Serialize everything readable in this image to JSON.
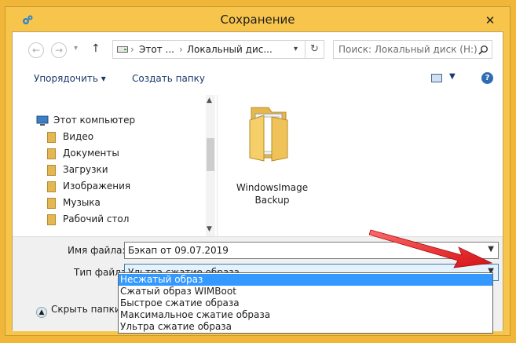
{
  "window": {
    "title": "Сохранение",
    "close_glyph": "✕"
  },
  "navigation": {
    "back_glyph": "←",
    "forward_glyph": "→",
    "recent_glyph": "▾",
    "up_glyph": "↑",
    "breadcrumb": [
      "Этот ...",
      "Локальный дис..."
    ],
    "breadcrumb_separator": "›",
    "address_dropdown_glyph": "▾",
    "refresh_glyph": "↻",
    "search_placeholder": "Поиск: Локальный диск (H:)"
  },
  "toolbar": {
    "organize_label": "Упорядочить ▾",
    "new_folder_label": "Создать папку",
    "view_caret": "▼",
    "help_glyph": "?"
  },
  "nav_pane": {
    "root": "Этот компьютер",
    "items": [
      "Видео",
      "Документы",
      "Загрузки",
      "Изображения",
      "Музыка",
      "Рабочий стол"
    ]
  },
  "content": {
    "items": [
      {
        "name": "WindowsImageBackup",
        "icon": "folder-icon"
      }
    ]
  },
  "form": {
    "file_name_label": "Имя файла:",
    "file_name_value": "Бэкап от 09.07.2019",
    "file_type_label": "Тип файла:",
    "file_type_value": "Ультра сжатие образа",
    "hide_folders_label": "Скрыть папки"
  },
  "file_type_options": [
    {
      "label": "Несжатый образ",
      "selected": true
    },
    {
      "label": "Сжатый образ WIMBoot",
      "selected": false
    },
    {
      "label": "Быстрое сжатие образа",
      "selected": false
    },
    {
      "label": "Максимальное сжатие образа",
      "selected": false
    },
    {
      "label": "Ультра сжатие образа",
      "selected": false
    }
  ],
  "colors": {
    "frame": "#f7c54b",
    "selection": "#3399ff",
    "annotation_arrow": "#e0161b"
  }
}
